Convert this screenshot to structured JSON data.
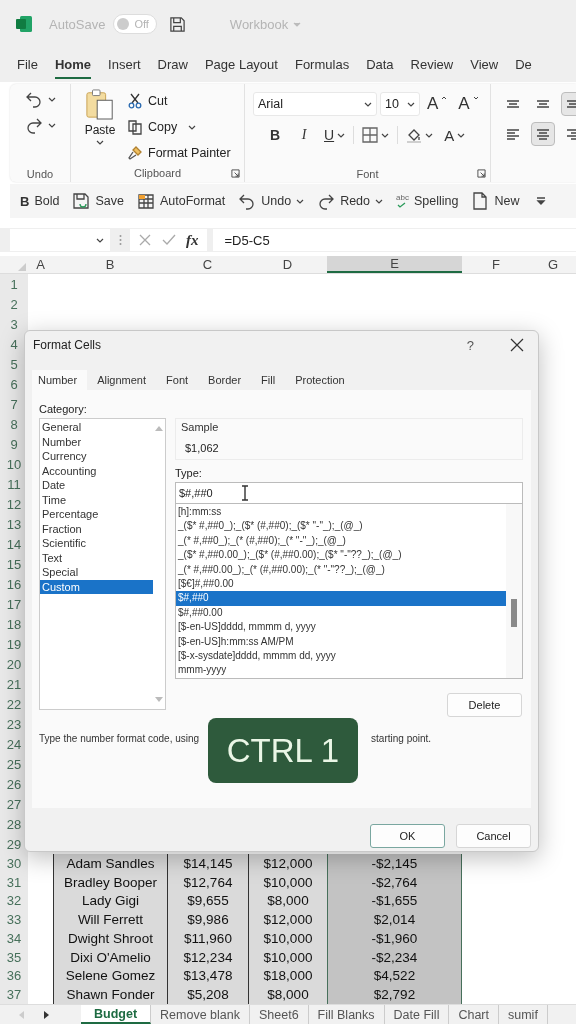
{
  "title_bar": {
    "autosave_label": "AutoSave",
    "autosave": {
      "on": false,
      "label": "Off"
    },
    "workbook": "Workbook"
  },
  "menu_tabs": [
    {
      "label": "File",
      "selected": false
    },
    {
      "label": "Home",
      "selected": true
    },
    {
      "label": "Insert",
      "selected": false
    },
    {
      "label": "Draw",
      "selected": false
    },
    {
      "label": "Page Layout",
      "selected": false
    },
    {
      "label": "Formulas",
      "selected": false
    },
    {
      "label": "Data",
      "selected": false
    },
    {
      "label": "Review",
      "selected": false
    },
    {
      "label": "View",
      "selected": false
    },
    {
      "label": "De",
      "selected": false
    }
  ],
  "ribbon": {
    "undo_group": {
      "label": "Undo"
    },
    "clipboard": {
      "paste": "Paste",
      "cut": "Cut",
      "copy": "Copy",
      "format_painter": "Format Painter",
      "label": "Clipboard"
    },
    "font": {
      "name": "Arial",
      "size": "10",
      "grow": "A",
      "shrink": "A",
      "bold": "B",
      "italic": "I",
      "underline": "U",
      "color_glyph": "A",
      "label": "Font"
    },
    "alignment": [
      {
        "kind": "top",
        "pressed": false
      },
      {
        "kind": "middle",
        "pressed": false
      },
      {
        "kind": "bottom",
        "pressed": true
      },
      {
        "kind": "left",
        "pressed": false
      },
      {
        "kind": "center",
        "pressed": true
      },
      {
        "kind": "right",
        "pressed": false
      }
    ]
  },
  "quick_access": [
    {
      "kind": "bold",
      "glyph": "B",
      "label": "Bold",
      "dropdown": false
    },
    {
      "kind": "save",
      "label": "Save",
      "dropdown": false
    },
    {
      "kind": "autoformat",
      "label": "AutoFormat",
      "dropdown": false
    },
    {
      "kind": "undo",
      "label": "Undo",
      "dropdown": true
    },
    {
      "kind": "redo",
      "label": "Redo",
      "dropdown": true
    },
    {
      "kind": "spelling",
      "glyph": "abc",
      "label": "Spelling",
      "dropdown": false
    },
    {
      "kind": "new",
      "label": "New",
      "dropdown": false
    }
  ],
  "formula_bar": {
    "fx": "fx",
    "formula": "=D5-C5"
  },
  "columns": [
    {
      "label": "A",
      "selected": false
    },
    {
      "label": "B",
      "selected": false
    },
    {
      "label": "C",
      "selected": false
    },
    {
      "label": "D",
      "selected": false
    },
    {
      "label": "E",
      "selected": true
    },
    {
      "label": "F",
      "selected": false
    },
    {
      "label": "G",
      "selected": false
    }
  ],
  "rows": [
    {
      "number": "1"
    },
    {
      "number": "2"
    },
    {
      "number": "3"
    },
    {
      "number": "4"
    },
    {
      "number": "5"
    },
    {
      "number": "6"
    },
    {
      "number": "7"
    },
    {
      "number": "8"
    },
    {
      "number": "9"
    },
    {
      "number": "10"
    },
    {
      "number": "11"
    },
    {
      "number": "12"
    },
    {
      "number": "13"
    },
    {
      "number": "14"
    },
    {
      "number": "15"
    },
    {
      "number": "16"
    },
    {
      "number": "17"
    },
    {
      "number": "18"
    },
    {
      "number": "19"
    },
    {
      "number": "20"
    },
    {
      "number": "21"
    },
    {
      "number": "22"
    },
    {
      "number": "23"
    },
    {
      "number": "24"
    },
    {
      "number": "25"
    },
    {
      "number": "26"
    },
    {
      "number": "27"
    },
    {
      "number": "28"
    },
    {
      "number": "29"
    },
    {
      "number": "30",
      "cells": [
        "Adam Sandles",
        "$14,145",
        "$12,000",
        "-$2,145"
      ]
    },
    {
      "number": "31",
      "cells": [
        "Bradley Booper",
        "$12,764",
        "$10,000",
        "-$2,764"
      ]
    },
    {
      "number": "32",
      "cells": [
        "Lady Gigi",
        "$9,655",
        "$8,000",
        "-$1,655"
      ]
    },
    {
      "number": "33",
      "cells": [
        "Will Ferrett",
        "$9,986",
        "$12,000",
        "$2,014"
      ]
    },
    {
      "number": "34",
      "cells": [
        "Dwight Shroot",
        "$11,960",
        "$10,000",
        "-$1,960"
      ]
    },
    {
      "number": "35",
      "cells": [
        "Dixi O'Amelio",
        "$12,234",
        "$10,000",
        "-$2,234"
      ]
    },
    {
      "number": "36",
      "cells": [
        "Selene Gomez",
        "$13,478",
        "$18,000",
        "$4,522"
      ]
    },
    {
      "number": "37",
      "cells": [
        "Shawn Fonder",
        "$5,208",
        "$8,000",
        "$2,792"
      ]
    }
  ],
  "dialog": {
    "title": "Format Cells",
    "help": "?",
    "tabs": [
      {
        "label": "Number",
        "selected": true
      },
      {
        "label": "Alignment",
        "selected": false
      },
      {
        "label": "Font",
        "selected": false
      },
      {
        "label": "Border",
        "selected": false
      },
      {
        "label": "Fill",
        "selected": false
      },
      {
        "label": "Protection",
        "selected": false
      }
    ],
    "category_label": "Category:",
    "categories": [
      {
        "label": "General",
        "selected": false
      },
      {
        "label": "Number",
        "selected": false
      },
      {
        "label": "Currency",
        "selected": false
      },
      {
        "label": "Accounting",
        "selected": false
      },
      {
        "label": "Date",
        "selected": false
      },
      {
        "label": "Time",
        "selected": false
      },
      {
        "label": "Percentage",
        "selected": false
      },
      {
        "label": "Fraction",
        "selected": false
      },
      {
        "label": "Scientific",
        "selected": false
      },
      {
        "label": "Text",
        "selected": false
      },
      {
        "label": "Special",
        "selected": false
      },
      {
        "label": "Custom",
        "selected": true
      }
    ],
    "sample_label": "Sample",
    "sample": "$1,062",
    "type_label": "Type:",
    "type_value": "$#,##0",
    "formats": [
      {
        "label": "[h]:mm:ss",
        "selected": false
      },
      {
        "label": "_($* #,##0_);_($* (#,##0);_($* \"-\"_);_(@_)",
        "selected": false
      },
      {
        "label": "_(* #,##0_);_(* (#,##0);_(* \"-\"_);_(@_)",
        "selected": false
      },
      {
        "label": "_($* #,##0.00_);_($* (#,##0.00);_($* \"-\"??_);_(@_)",
        "selected": false
      },
      {
        "label": "_(* #,##0.00_);_(* (#,##0.00);_(* \"-\"??_);_(@_)",
        "selected": false
      },
      {
        "label": "[$€]#,##0.00",
        "selected": false
      },
      {
        "label": "$#,##0",
        "selected": true
      },
      {
        "label": "$#,##0.00",
        "selected": false
      },
      {
        "label": "[$-en-US]dddd, mmmm d, yyyy",
        "selected": false
      },
      {
        "label": "[$-en-US]h:mm:ss AM/PM",
        "selected": false
      },
      {
        "label": "[$-x-sysdate]dddd, mmmm dd, yyyy",
        "selected": false
      },
      {
        "label": "mmm-yyyy",
        "selected": false
      }
    ],
    "delete": "Delete",
    "description": [
      "Type the number format code, using",
      "starting point."
    ],
    "ok": "OK",
    "cancel": "Cancel"
  },
  "caption": "CTRL 1",
  "sheet_tabs": [
    {
      "label": "Budget",
      "selected": true
    },
    {
      "label": "Remove blank",
      "selected": false
    },
    {
      "label": "Sheet6",
      "selected": false
    },
    {
      "label": "Fill Blanks",
      "selected": false
    },
    {
      "label": "Date Fill",
      "selected": false
    },
    {
      "label": "Chart",
      "selected": false
    },
    {
      "label": "sumif",
      "selected": false
    }
  ]
}
